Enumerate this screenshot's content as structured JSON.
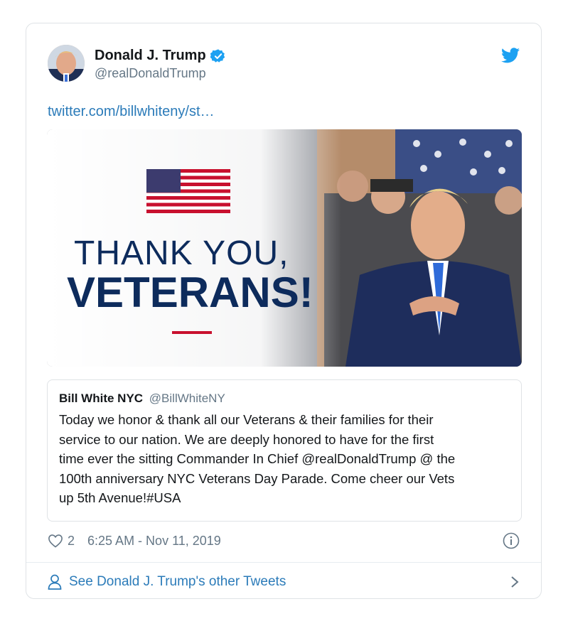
{
  "tweet": {
    "display_name": "Donald J. Trump",
    "handle": "@realDonaldTrump",
    "link_text": "twitter.com/billwhiteny/st…",
    "media": {
      "headline_line1": "THANK YOU,",
      "headline_line2": "VETERANS!"
    },
    "quote": {
      "name": "Bill White NYC",
      "handle": "@BillWhiteNY",
      "text": "Today we honor & thank all our Veterans & their families for their\nservice to our nation. We are deeply honored to have for the first\ntime ever the sitting Commander In Chief @realDonaldTrump @ the\n100th anniversary NYC Veterans Day Parade. Come cheer our Vets\nup 5th Avenue!#USA"
    },
    "likes": "2",
    "timestamp": "6:25 AM - Nov 11, 2019",
    "footer_link": "See Donald J. Trump's other Tweets"
  },
  "icons": {
    "verified": "verified-badge-icon",
    "brand": "twitter-bird-icon",
    "like": "heart-icon",
    "info": "info-icon",
    "profile": "person-icon",
    "chevron": "chevron-right-icon"
  },
  "colors": {
    "link": "#2b7bb9",
    "verified": "#1da1f2",
    "headline": "#0d2b5c",
    "accent_red": "#c8102e"
  }
}
